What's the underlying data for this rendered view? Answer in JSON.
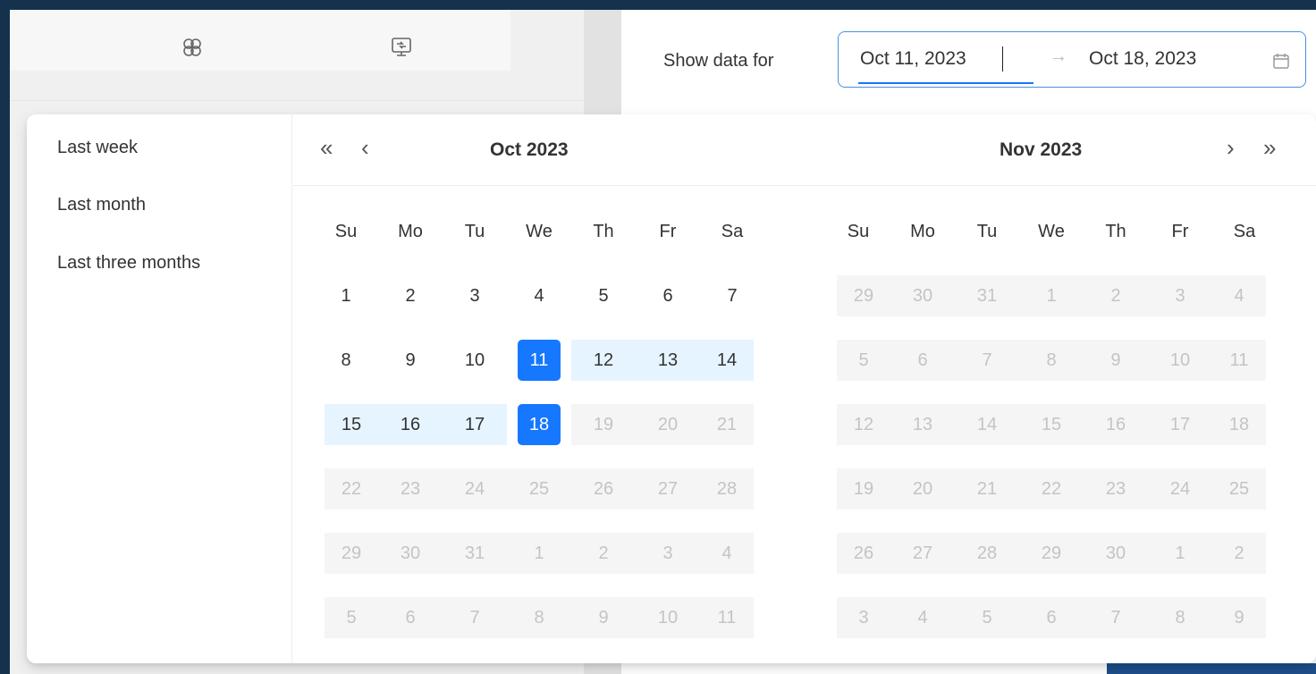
{
  "range_picker": {
    "label": "Show data for",
    "start_value": "Oct 11, 2023",
    "end_value": "Oct 18, 2023",
    "separator": "→"
  },
  "presets": [
    "Last week",
    "Last month",
    "Last three months"
  ],
  "nav": {
    "prev_year": "«",
    "prev_month": "‹",
    "next_month": "›",
    "next_year": "»"
  },
  "weekdays": [
    "Su",
    "Mo",
    "Tu",
    "We",
    "Th",
    "Fr",
    "Sa"
  ],
  "months": [
    {
      "title": "Oct  2023",
      "weeks": [
        [
          {
            "d": "1"
          },
          {
            "d": "2"
          },
          {
            "d": "3"
          },
          {
            "d": "4"
          },
          {
            "d": "5"
          },
          {
            "d": "6"
          },
          {
            "d": "7"
          }
        ],
        [
          {
            "d": "8"
          },
          {
            "d": "9"
          },
          {
            "d": "10"
          },
          {
            "d": "11",
            "s": "selected"
          },
          {
            "d": "12",
            "s": "in-range"
          },
          {
            "d": "13",
            "s": "in-range"
          },
          {
            "d": "14",
            "s": "in-range"
          }
        ],
        [
          {
            "d": "15",
            "s": "in-range"
          },
          {
            "d": "16",
            "s": "in-range"
          },
          {
            "d": "17",
            "s": "in-range"
          },
          {
            "d": "18",
            "s": "selected"
          },
          {
            "d": "19",
            "s": "out"
          },
          {
            "d": "20",
            "s": "out"
          },
          {
            "d": "21",
            "s": "out"
          }
        ],
        [
          {
            "d": "22",
            "s": "out"
          },
          {
            "d": "23",
            "s": "out"
          },
          {
            "d": "24",
            "s": "out"
          },
          {
            "d": "25",
            "s": "out"
          },
          {
            "d": "26",
            "s": "out"
          },
          {
            "d": "27",
            "s": "out"
          },
          {
            "d": "28",
            "s": "out"
          }
        ],
        [
          {
            "d": "29",
            "s": "out"
          },
          {
            "d": "30",
            "s": "out"
          },
          {
            "d": "31",
            "s": "out"
          },
          {
            "d": "1",
            "s": "out"
          },
          {
            "d": "2",
            "s": "out"
          },
          {
            "d": "3",
            "s": "out"
          },
          {
            "d": "4",
            "s": "out"
          }
        ],
        [
          {
            "d": "5",
            "s": "out"
          },
          {
            "d": "6",
            "s": "out"
          },
          {
            "d": "7",
            "s": "out"
          },
          {
            "d": "8",
            "s": "out"
          },
          {
            "d": "9",
            "s": "out"
          },
          {
            "d": "10",
            "s": "out"
          },
          {
            "d": "11",
            "s": "out"
          }
        ]
      ]
    },
    {
      "title": "Nov  2023",
      "weeks": [
        [
          {
            "d": "29",
            "s": "out"
          },
          {
            "d": "30",
            "s": "out"
          },
          {
            "d": "31",
            "s": "out"
          },
          {
            "d": "1",
            "s": "out"
          },
          {
            "d": "2",
            "s": "out"
          },
          {
            "d": "3",
            "s": "out"
          },
          {
            "d": "4",
            "s": "out"
          }
        ],
        [
          {
            "d": "5",
            "s": "out"
          },
          {
            "d": "6",
            "s": "out"
          },
          {
            "d": "7",
            "s": "out"
          },
          {
            "d": "8",
            "s": "out"
          },
          {
            "d": "9",
            "s": "out"
          },
          {
            "d": "10",
            "s": "out"
          },
          {
            "d": "11",
            "s": "out"
          }
        ],
        [
          {
            "d": "12",
            "s": "out"
          },
          {
            "d": "13",
            "s": "out"
          },
          {
            "d": "14",
            "s": "out"
          },
          {
            "d": "15",
            "s": "out"
          },
          {
            "d": "16",
            "s": "out"
          },
          {
            "d": "17",
            "s": "out"
          },
          {
            "d": "18",
            "s": "out"
          }
        ],
        [
          {
            "d": "19",
            "s": "out"
          },
          {
            "d": "20",
            "s": "out"
          },
          {
            "d": "21",
            "s": "out"
          },
          {
            "d": "22",
            "s": "out"
          },
          {
            "d": "23",
            "s": "out"
          },
          {
            "d": "24",
            "s": "out"
          },
          {
            "d": "25",
            "s": "out"
          }
        ],
        [
          {
            "d": "26",
            "s": "out"
          },
          {
            "d": "27",
            "s": "out"
          },
          {
            "d": "28",
            "s": "out"
          },
          {
            "d": "29",
            "s": "out"
          },
          {
            "d": "30",
            "s": "out"
          },
          {
            "d": "1",
            "s": "out"
          },
          {
            "d": "2",
            "s": "out"
          }
        ],
        [
          {
            "d": "3",
            "s": "out"
          },
          {
            "d": "4",
            "s": "out"
          },
          {
            "d": "5",
            "s": "out"
          },
          {
            "d": "6",
            "s": "out"
          },
          {
            "d": "7",
            "s": "out"
          },
          {
            "d": "8",
            "s": "out"
          },
          {
            "d": "9",
            "s": "out"
          }
        ]
      ]
    }
  ],
  "icons": {
    "toolbar_1": "pattern-icon",
    "toolbar_2": "screen-share-icon",
    "picker_suffix": "calendar-icon"
  },
  "colors": {
    "accent": "#1677ff",
    "range_fill": "#e6f4ff",
    "frame": "#14324b"
  }
}
